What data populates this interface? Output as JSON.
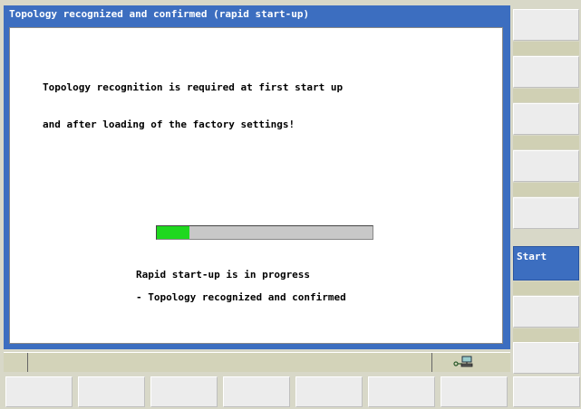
{
  "dialog": {
    "title": "Topology recognized and confirmed (rapid start-up)",
    "message_line1": "Topology recognition is required at first start up",
    "message_line2": "and after loading of the factory settings!",
    "progress_percent": 15,
    "status_line1": "Rapid start-up is in progress",
    "status_line2": "- Topology recognized and confirmed"
  },
  "statusbar": {
    "icon": "network-connection-icon"
  },
  "vertical_softkeys": [
    {
      "label": ""
    },
    {
      "label": ""
    },
    {
      "label": ""
    },
    {
      "label": ""
    },
    {
      "label": ""
    },
    {
      "label": "Start"
    },
    {
      "label": ""
    },
    {
      "label": ""
    }
  ],
  "horizontal_softkeys": [
    {
      "label": ""
    },
    {
      "label": ""
    },
    {
      "label": ""
    },
    {
      "label": ""
    },
    {
      "label": ""
    },
    {
      "label": ""
    },
    {
      "label": ""
    },
    {
      "label": ""
    }
  ],
  "colors": {
    "title_bar": "#3c6ec0",
    "progress_fill": "#1fd81f",
    "active_softkey": "#3c6ec0"
  }
}
